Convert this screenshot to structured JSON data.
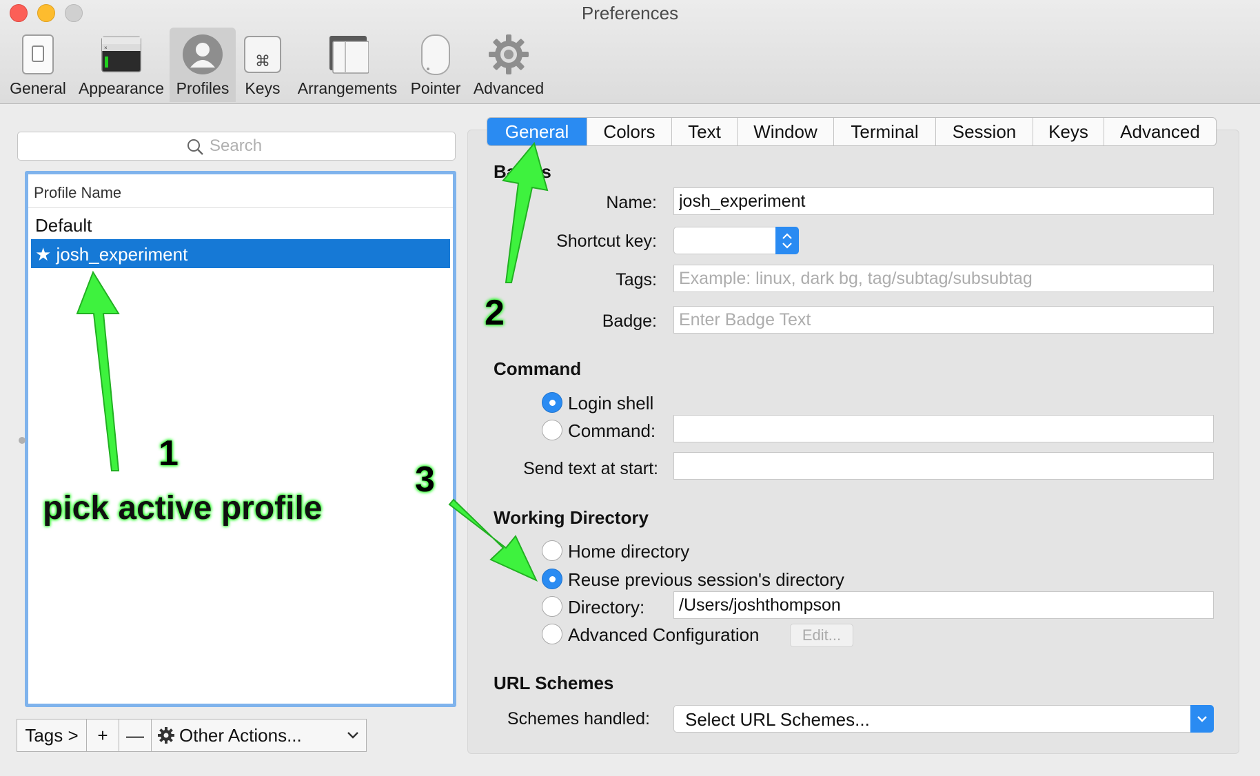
{
  "window": {
    "title": "Preferences"
  },
  "toolbar": [
    {
      "label": "General",
      "icon": "general-switch-icon"
    },
    {
      "label": "Appearance",
      "icon": "appearance-window-icon"
    },
    {
      "label": "Profiles",
      "icon": "profiles-user-icon",
      "active": true
    },
    {
      "label": "Keys",
      "icon": "keys-command-icon"
    },
    {
      "label": "Arrangements",
      "icon": "arrangements-window-icon"
    },
    {
      "label": "Pointer",
      "icon": "pointer-mouse-icon"
    },
    {
      "label": "Advanced",
      "icon": "advanced-gear-icon"
    }
  ],
  "search": {
    "placeholder": "Search"
  },
  "profiles": {
    "header": "Profile Name",
    "items": [
      {
        "name": "Default",
        "selected": false
      },
      {
        "name": "★ josh_experiment",
        "selected": true
      }
    ]
  },
  "bottom_bar": {
    "tags": "Tags >",
    "add": "+",
    "remove": "—",
    "other": "Other Actions..."
  },
  "tabs": [
    "General",
    "Colors",
    "Text",
    "Window",
    "Terminal",
    "Session",
    "Keys",
    "Advanced"
  ],
  "active_tab": "General",
  "basics": {
    "heading": "Basics",
    "name_label": "Name:",
    "name_value": "josh_experiment",
    "shortcut_label": "Shortcut key:",
    "tags_label": "Tags:",
    "tags_placeholder": "Example: linux, dark bg, tag/subtag/subsubtag",
    "badge_label": "Badge:",
    "badge_placeholder": "Enter Badge Text"
  },
  "command": {
    "heading": "Command",
    "login_shell": "Login shell",
    "command_label": "Command:",
    "command_value": "",
    "send_text_label": "Send text at start:",
    "send_text_value": "",
    "selected": "login_shell"
  },
  "working_directory": {
    "heading": "Working Directory",
    "home": "Home directory",
    "reuse": "Reuse previous session's directory",
    "directory_label": "Directory:",
    "directory_value": "/Users/joshthompson",
    "advanced": "Advanced Configuration",
    "edit": "Edit...",
    "selected": "reuse"
  },
  "url_schemes": {
    "heading": "URL Schemes",
    "label": "Schemes handled:",
    "select": "Select URL Schemes..."
  },
  "annotations": {
    "one": "1",
    "pick": "pick active profile",
    "two": "2",
    "three": "3"
  },
  "colors": {
    "accent": "#2a8bf2",
    "selection": "#1679d6",
    "annotation": "#3eff3e"
  }
}
